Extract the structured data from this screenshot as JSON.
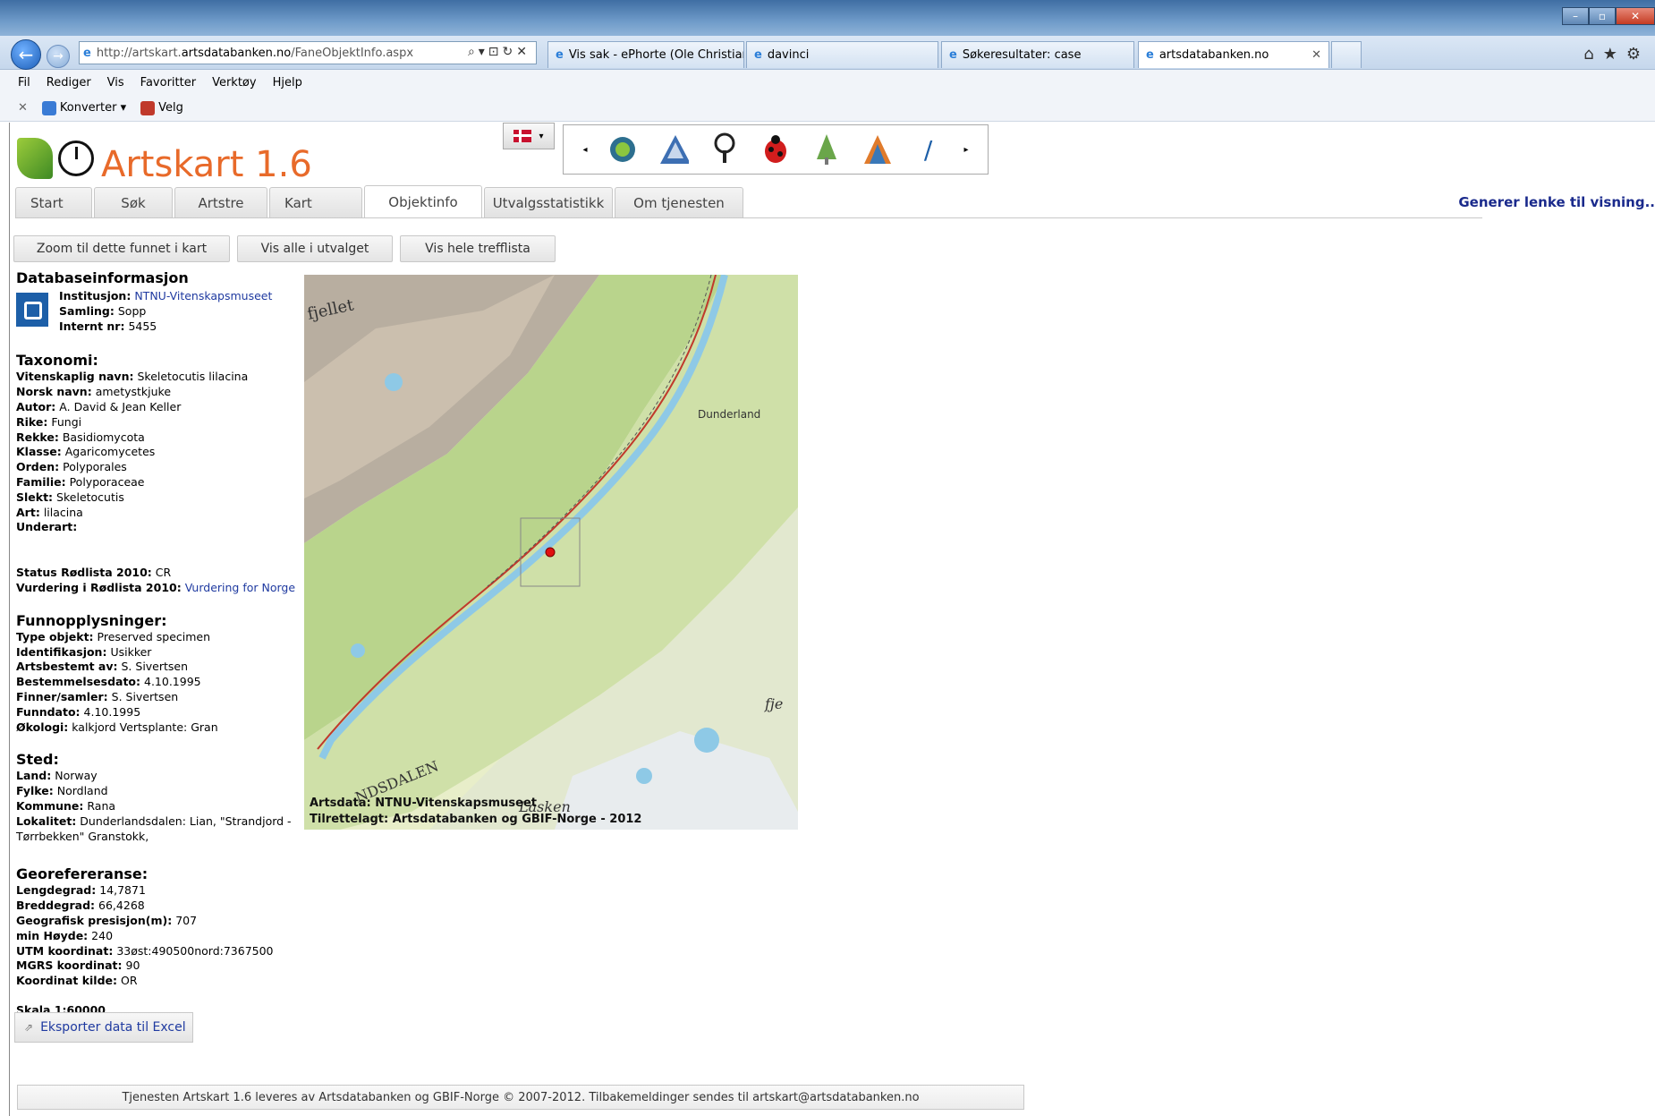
{
  "browser": {
    "address": {
      "prefix": "http://artskart.",
      "host": "artsdatabanken.no",
      "path": "/FaneObjektInfo.aspx"
    },
    "tabs": [
      {
        "label": "Vis sak - ePhorte (Ole Christian..."
      },
      {
        "label": "davinci"
      },
      {
        "label": "Søkeresultater: case"
      },
      {
        "label": "artsdatabanken.no"
      }
    ],
    "menu": [
      "Fil",
      "Rediger",
      "Vis",
      "Favoritter",
      "Verktøy",
      "Hjelp"
    ],
    "toolbar": {
      "convert": "Konverter",
      "select": "Velg"
    }
  },
  "page": {
    "logo_text": "Artskart 1.6",
    "tabs": [
      "Start",
      "Søk",
      "Artstre",
      "Kart",
      "Objektinfo",
      "Utvalgsstatistikk",
      "Om tjenesten"
    ],
    "active_tab": "Objektinfo",
    "generate_link": "Generer lenke til visning..",
    "actions": [
      "Zoom til dette funnet i kart",
      "Vis alle i utvalget",
      "Vis hele trefflista"
    ],
    "db": {
      "title": "Databaseinformasjon",
      "institution_label": "Institusjon:",
      "institution": "NTNU-Vitenskapsmuseet",
      "collection_label": "Samling:",
      "collection": "Sopp",
      "internal_label": "Internt nr:",
      "internal": "5455"
    },
    "taxonomy": {
      "title": "Taxonomi:",
      "rows": [
        {
          "label": "Vitenskaplig navn:",
          "value": "Skeletocutis lilacina"
        },
        {
          "label": "Norsk navn:",
          "value": "ametystkjuke"
        },
        {
          "label": "Autor:",
          "value": "A. David & Jean Keller"
        },
        {
          "label": "Rike:",
          "value": "Fungi"
        },
        {
          "label": "Rekke:",
          "value": "Basidiomycota"
        },
        {
          "label": "Klasse:",
          "value": "Agaricomycetes"
        },
        {
          "label": "Orden:",
          "value": "Polyporales"
        },
        {
          "label": "Familie:",
          "value": "Polyporaceae"
        },
        {
          "label": "Slekt:",
          "value": "Skeletocutis"
        },
        {
          "label": "Art:",
          "value": "lilacina"
        },
        {
          "label": "Underart:",
          "value": ""
        }
      ]
    },
    "status": {
      "redlist_label": "Status Rødlista 2010:",
      "redlist": "CR",
      "assess_label": "Vurdering i Rødlista 2010:",
      "assess": "Vurdering for Norge"
    },
    "find": {
      "title": "Funnopplysninger:",
      "rows": [
        {
          "label": "Type objekt:",
          "value": "Preserved specimen"
        },
        {
          "label": "Identifikasjon:",
          "value": "Usikker"
        },
        {
          "label": "Artsbestemt av:",
          "value": "S. Sivertsen"
        },
        {
          "label": "Bestemmelsesdato:",
          "value": "4.10.1995"
        },
        {
          "label": "Finner/samler:",
          "value": "S. Sivertsen"
        },
        {
          "label": "Funndato:",
          "value": "4.10.1995"
        },
        {
          "label": "Økologi:",
          "value": "kalkjord Vertsplante: Gran"
        }
      ]
    },
    "place": {
      "title": "Sted:",
      "rows": [
        {
          "label": "Land:",
          "value": "Norway"
        },
        {
          "label": "Fylke:",
          "value": "Nordland"
        },
        {
          "label": "Kommune:",
          "value": "Rana"
        },
        {
          "label": "Lokalitet:",
          "value": "Dunderlandsdalen: Lian, \"Strandjord - Tørrbekken\" Granstokk,"
        }
      ]
    },
    "geo": {
      "title": "Georefereranse:",
      "rows": [
        {
          "label": "Lengdegrad:",
          "value": "14,7871"
        },
        {
          "label": "Breddegrad:",
          "value": "66,4268"
        },
        {
          "label": "Geografisk presisjon(m):",
          "value": "707"
        },
        {
          "label": "min Høyde:",
          "value": "240"
        },
        {
          "label": "UTM koordinat:",
          "value": "33øst:490500nord:7367500"
        },
        {
          "label": "MGRS koordinat:",
          "value": "90"
        },
        {
          "label": "Koordinat kilde:",
          "value": "OR"
        }
      ]
    },
    "scale": "Skala 1:60000",
    "map": {
      "caption1": "Artsdata: NTNU-Vitenskapsmuseet",
      "caption2": "Tilrettelagt: Artsdatabanken og GBIF-Norge - 2012",
      "labels": [
        "fjellet",
        "Dunderland",
        "Lasken",
        "NDSDALEN",
        "fje"
      ],
      "colors": {
        "forest": "#b9d48c",
        "field": "#e7edc8",
        "mountain": "#b8aea0",
        "water": "#8ec9e6",
        "road": "#c0392b",
        "point": "#e01010"
      }
    },
    "export": "Eksporter data til Excel",
    "footer": "Tjenesten Artskart 1.6 leveres av Artsdatabanken og GBIF-Norge © 2007-2012. Tilbakemeldinger sendes til artskart@artsdatabanken.no"
  }
}
